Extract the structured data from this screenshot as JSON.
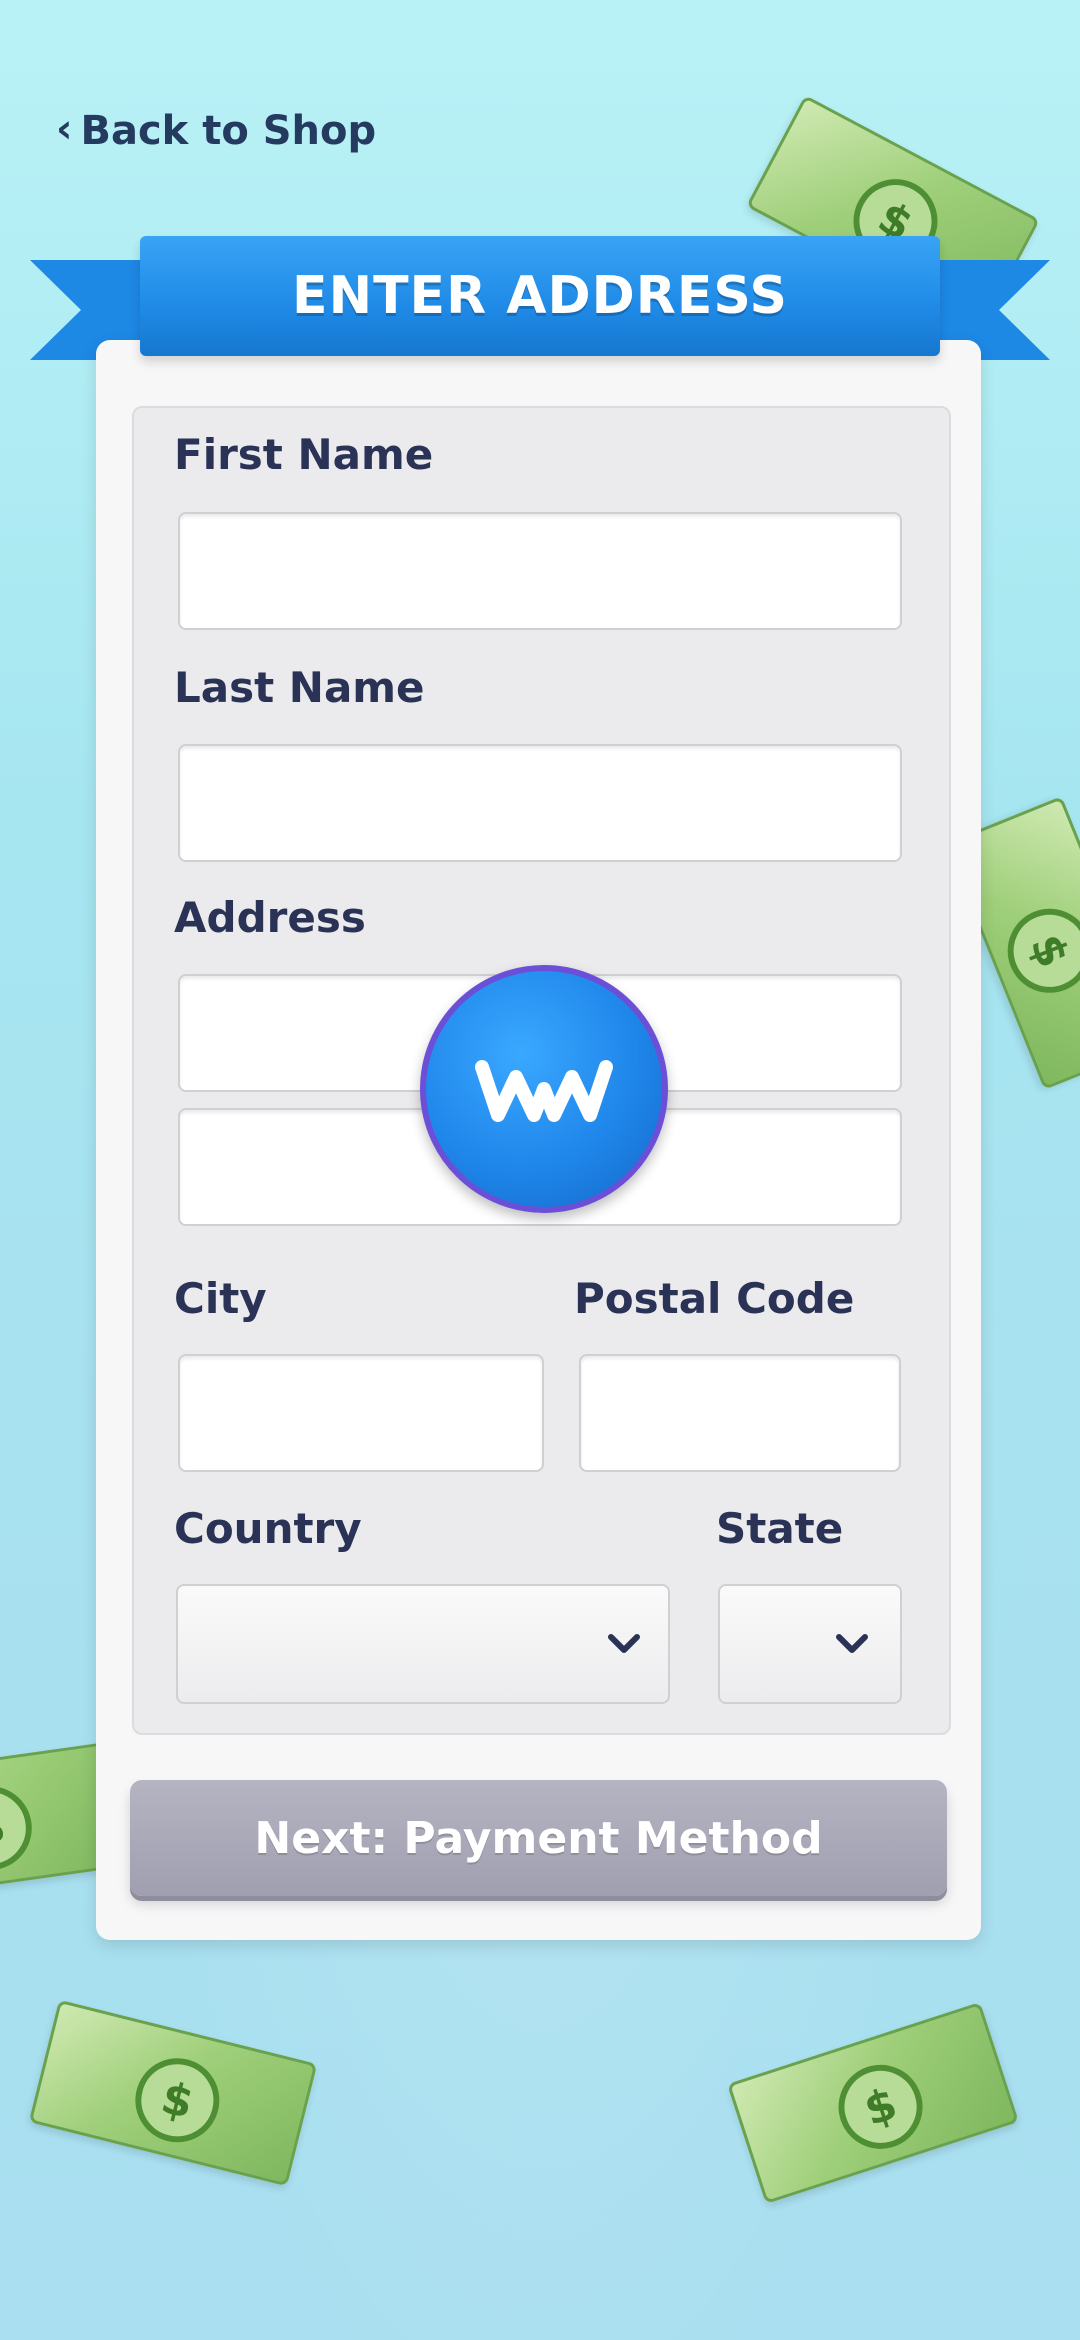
{
  "header": {
    "back_label": "Back to Shop",
    "title": "ENTER ADDRESS"
  },
  "form": {
    "first_name_label": "First Name",
    "first_name_value": "",
    "last_name_label": "Last Name",
    "last_name_value": "",
    "address_label": "Address",
    "address_line1_value": "",
    "address_line2_value": "",
    "city_label": "City",
    "city_value": "",
    "postal_code_label": "Postal Code",
    "postal_code_value": "",
    "country_label": "Country",
    "country_selected": "",
    "state_label": "State",
    "state_selected": ""
  },
  "actions": {
    "next_label": "Next: Payment Method"
  },
  "icons": {
    "back": "chevron-left-icon",
    "select": "chevron-down-icon",
    "logo": "app-logo-icon",
    "bill": "dollar-bill-icon"
  },
  "colors": {
    "accent": "#1f8ae6",
    "text": "#2a3256",
    "button_disabled": "#a9a8b8"
  }
}
